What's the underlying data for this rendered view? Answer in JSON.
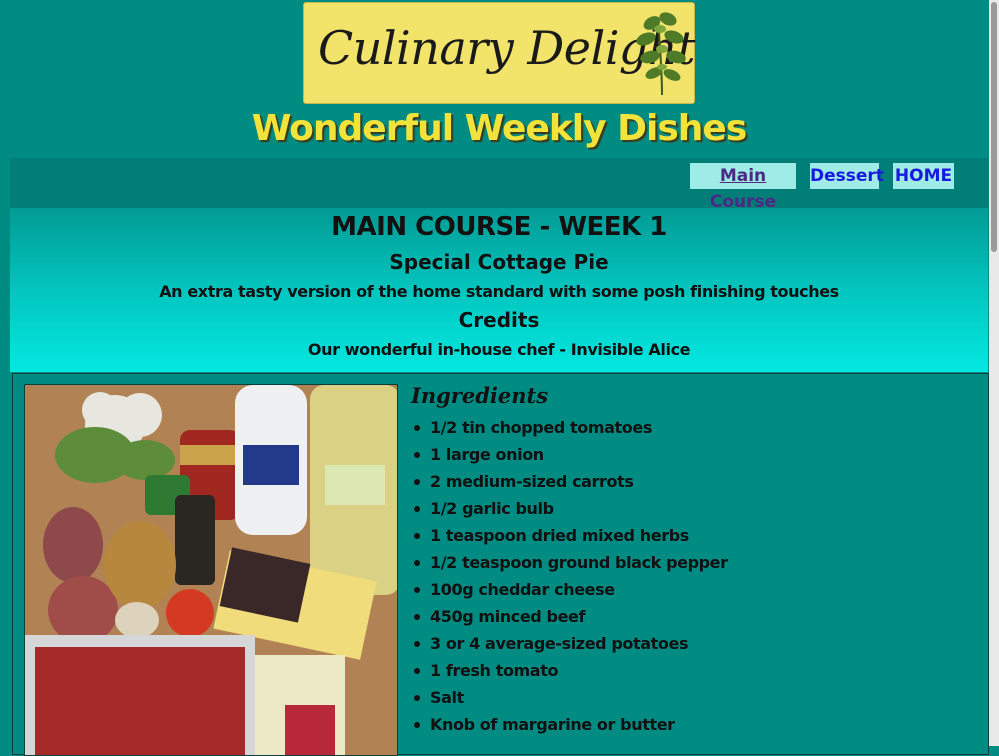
{
  "header": {
    "logo_text": "Culinary Delight",
    "site_title": "Wonderful Weekly Dishes"
  },
  "nav": {
    "items": [
      {
        "label": "Main Course",
        "active": true
      },
      {
        "label": "Dessert",
        "active": false
      },
      {
        "label": "HOME",
        "active": false
      }
    ]
  },
  "hero": {
    "heading": "MAIN COURSE - WEEK 1",
    "dish_name": "Special Cottage Pie",
    "description": "An extra tasty version of the home standard with some posh finishing touches",
    "credits_heading": "Credits",
    "credits_text": "Our wonderful in-house chef - Invisible Alice"
  },
  "ingredients": {
    "title": "Ingredients",
    "items": [
      "1/2 tin chopped tomatoes",
      "1 large onion",
      "2 medium-sized carrots",
      "1/2 garlic bulb",
      "1 teaspoon dried mixed herbs",
      "1/2 teaspoon ground black pepper",
      "100g cheddar cheese",
      "450g minced beef",
      "3 or 4 average-sized potatoes",
      "1 fresh tomato",
      "Salt",
      "Knob of margarine or butter"
    ]
  },
  "colors": {
    "page_bg": "#008b83",
    "logo_bg": "#f2e36a",
    "title_yellow": "#f2e33a",
    "nav_button_bg": "#9fece6",
    "nav_link": "#1a1adf",
    "nav_visited": "#4a2a86"
  },
  "icons": [
    "herb-sprig-icon"
  ]
}
